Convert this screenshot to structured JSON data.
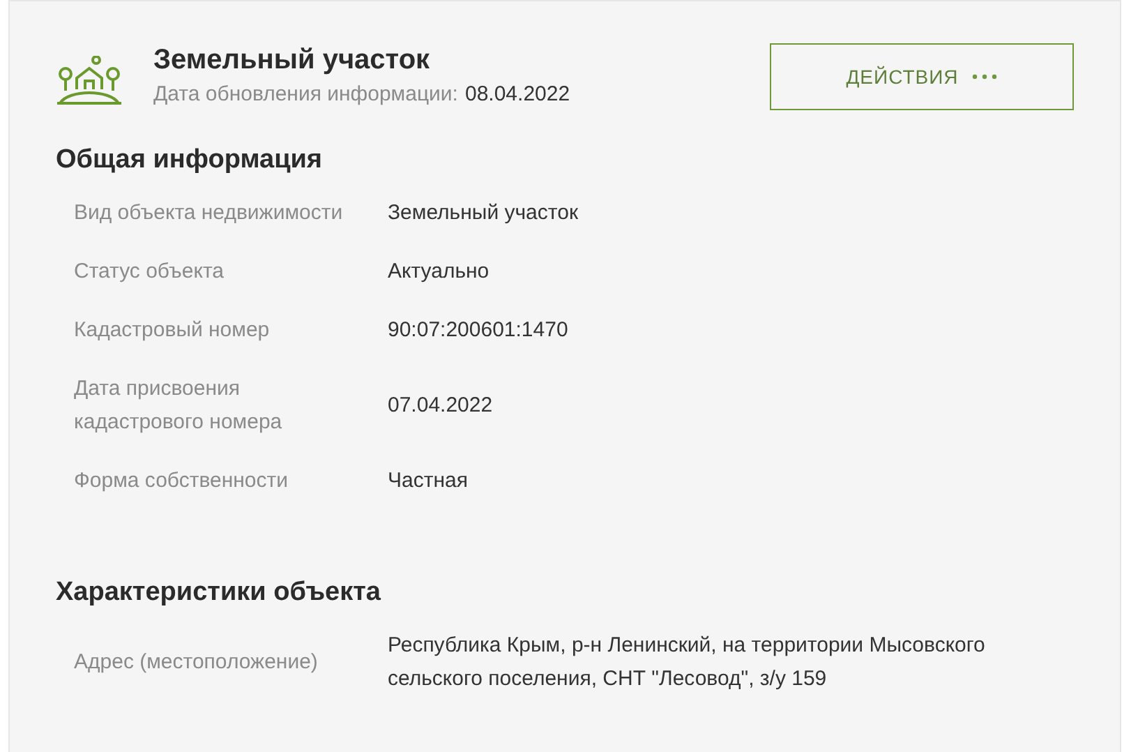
{
  "header": {
    "title": "Земельный участок",
    "updated_label": "Дата обновления информации:",
    "updated_date": "08.04.2022",
    "actions_button": "ДЕЙСТВИЯ"
  },
  "sections": [
    {
      "title": "Общая информация",
      "rows": [
        {
          "label": "Вид объекта недвижимости",
          "value": "Земельный участок"
        },
        {
          "label": "Статус объекта",
          "value": "Актуально"
        },
        {
          "label": "Кадастровый номер",
          "value": "90:07:200601:1470"
        },
        {
          "label": "Дата присвоения кадастрового номера",
          "value": "07.04.2022"
        },
        {
          "label": "Форма собственности",
          "value": "Частная"
        }
      ]
    },
    {
      "title": "Характеристики объекта",
      "rows": [
        {
          "label": "Адрес (местоположение)",
          "value": "Республика Крым, р-н Ленинский, на территории Мысовского сельского поселения, СНТ \"Лесовод\", з/у 159"
        }
      ]
    }
  ]
}
